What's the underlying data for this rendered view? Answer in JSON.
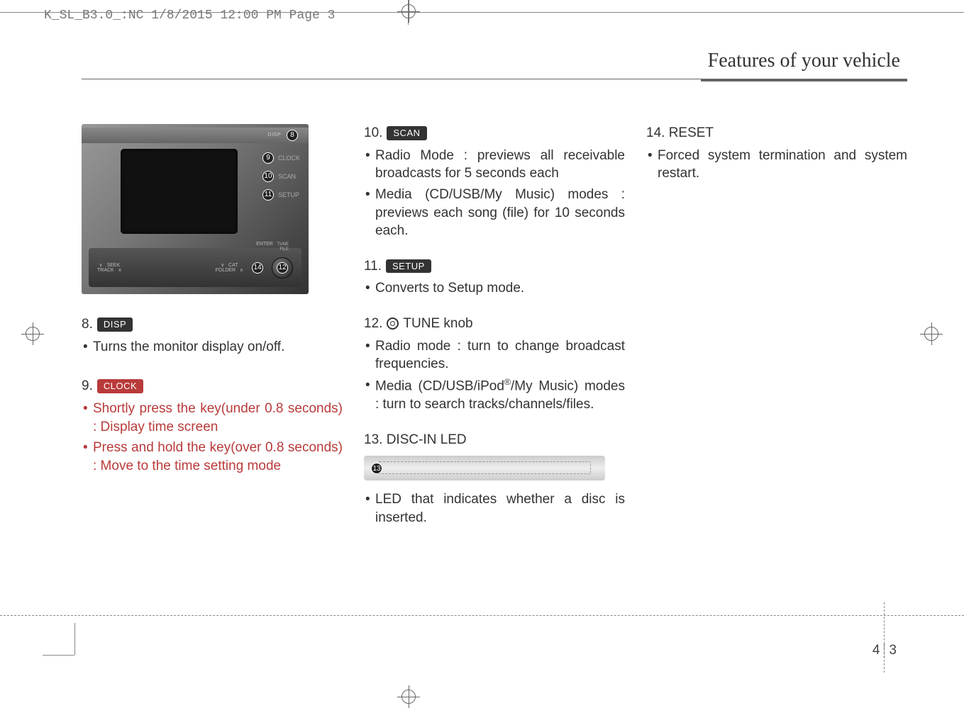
{
  "header": {
    "slug": "K_SL_B3.0_:NC  1/8/2015  12:00 PM  Page 3"
  },
  "section_title": "Features of your vehicle",
  "col1": {
    "item8": {
      "num": "8.",
      "label": "DISP",
      "bullets": [
        "Turns the monitor display on/off."
      ]
    },
    "item9": {
      "num": "9.",
      "label": "CLOCK",
      "bullets": [
        "Shortly press the key(under 0.8 seconds) : Display time screen",
        "Press and hold the key(over 0.8 seconds) : Move to the time setting mode"
      ]
    },
    "dash_labels": {
      "top_disp": "DISP",
      "clock": "CLOCK",
      "scan": "SCAN",
      "setup": "SETUP",
      "enter": "ENTER",
      "tune_file": "TUNE\nFILE",
      "seek_track": "SEEK\nTRACK",
      "cat_folder": "CAT\nFOLDER"
    }
  },
  "col2": {
    "item10": {
      "num": "10.",
      "label": "SCAN",
      "bullets": [
        "Radio Mode : previews all receivable broadcasts for 5 seconds each",
        "Media (CD/USB/My Music) modes : previews each song (file) for 10 seconds each."
      ]
    },
    "item11": {
      "num": "11.",
      "label": "SETUP",
      "bullets": [
        "Converts to Setup mode."
      ]
    },
    "item12": {
      "num": "12.",
      "title_suffix": "TUNE knob",
      "bullets": [
        "Radio mode : turn to change broadcast frequencies.",
        "Media (CD/USB/iPod®/My Music) modes : turn to search tracks/channels/files."
      ]
    },
    "item13": {
      "title": "13. DISC-IN LED",
      "bullets": [
        "LED that indicates whether a disc is inserted."
      ]
    }
  },
  "col3": {
    "item14": {
      "title": "14. RESET",
      "bullets": [
        "Forced system termination and system restart."
      ]
    }
  },
  "page": {
    "chapter": "4",
    "number": "3"
  }
}
